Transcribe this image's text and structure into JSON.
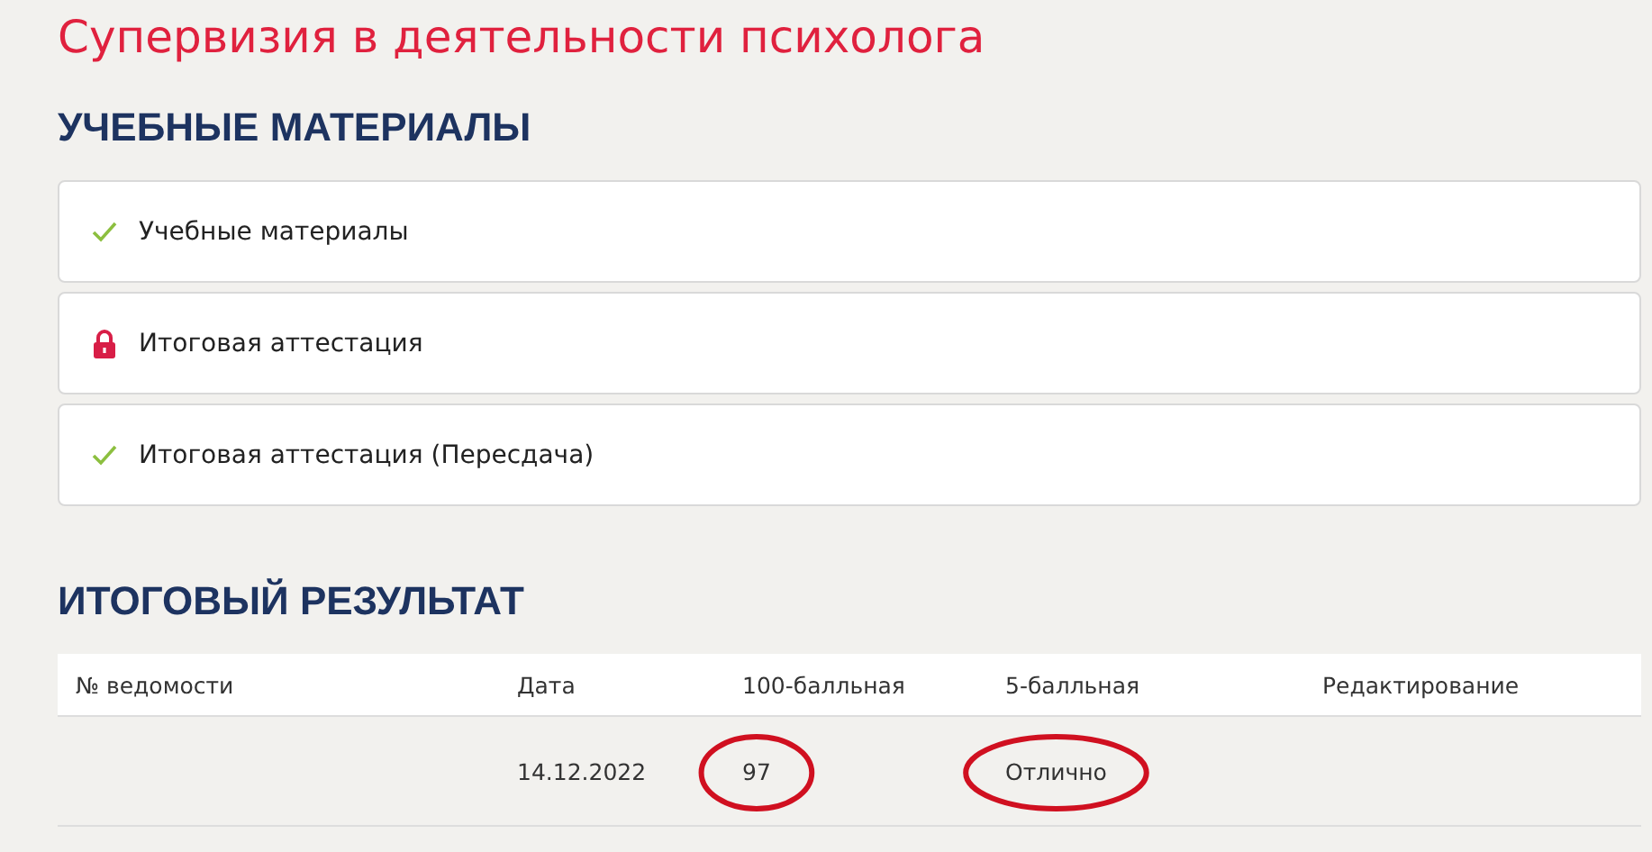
{
  "page_title": "Супервизия в деятельности психолога",
  "materials": {
    "heading": "УЧЕБНЫЕ МАТЕРИАЛЫ",
    "items": [
      {
        "label": "Учебные материалы",
        "kind": "done"
      },
      {
        "label": "Итоговая аттестация",
        "kind": "locked"
      },
      {
        "label": "Итоговая аттестация (Пересдача)",
        "kind": "done"
      }
    ]
  },
  "result": {
    "heading": "ИТОГОВЫЙ РЕЗУЛЬТАТ",
    "columns": [
      "№ ведомости",
      "Дата",
      "100-балльная",
      "5-балльная",
      "Редактирование"
    ],
    "rows": [
      {
        "date": {
          "text": "14.12.2022"
        },
        "score_100": {
          "text": "97",
          "circled": true
        },
        "score_5": {
          "text": "Отлично",
          "circled": true
        }
      }
    ]
  }
}
